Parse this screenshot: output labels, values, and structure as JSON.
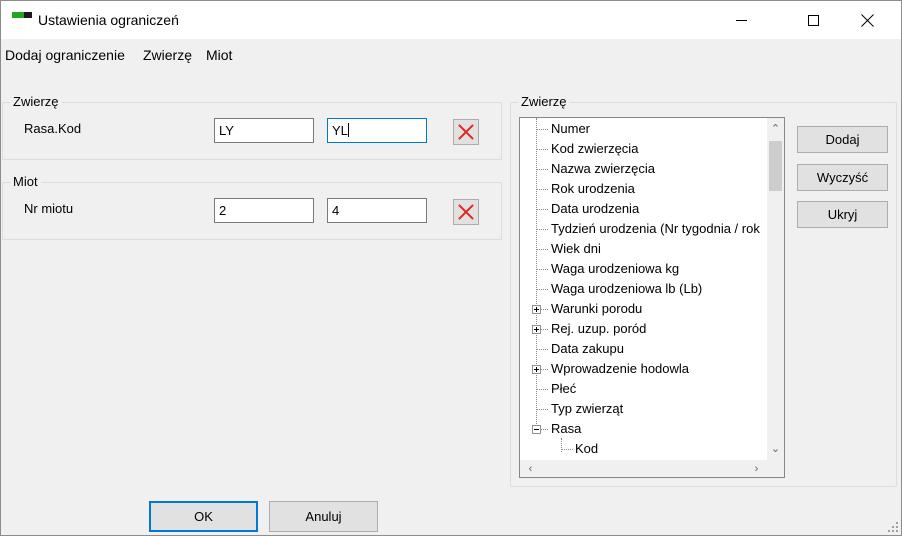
{
  "window": {
    "title": "Ustawienia ograniczeń",
    "icon": "app-icon",
    "controls": {
      "minimize": "minimize-icon",
      "maximize": "maximize-icon",
      "close": "close-icon"
    }
  },
  "menu": [
    "Dodaj ograniczenie",
    "Zwierzę",
    "Miot"
  ],
  "groups": {
    "zwierze": {
      "legend": "Zwierzę",
      "field_label": "Rasa.Kod",
      "value1": "LY",
      "value2": "YL"
    },
    "miot": {
      "legend": "Miot",
      "field_label": "Nr miotu",
      "value1": "2",
      "value2": "4"
    }
  },
  "tree": {
    "legend": "Zwierzę",
    "items": [
      "Numer",
      "Kod zwierzęcia",
      "Nazwa zwierzęcia",
      "Rok urodzenia",
      "Data urodzenia",
      "Tydzień urodzenia (Nr tygodnia / rok",
      "Wiek dni",
      "Waga urodzeniowa kg",
      "Waga urodzeniowa lb (Lb)",
      "Warunki porodu",
      "Rej. uzup. poród",
      "Data zakupu",
      "Wprowadzenie hodowla",
      "Płeć",
      "Typ zwierząt",
      "Rasa",
      "Kod"
    ]
  },
  "side_buttons": {
    "add": "Dodaj",
    "clear": "Wyczyść",
    "hide": "Ukryj"
  },
  "footer": {
    "ok": "OK",
    "cancel": "Anuluj"
  },
  "colors": {
    "delete_icon": "#e8231b",
    "focus_border": "#0078d7",
    "app_icon_green": "#1fa81f"
  }
}
